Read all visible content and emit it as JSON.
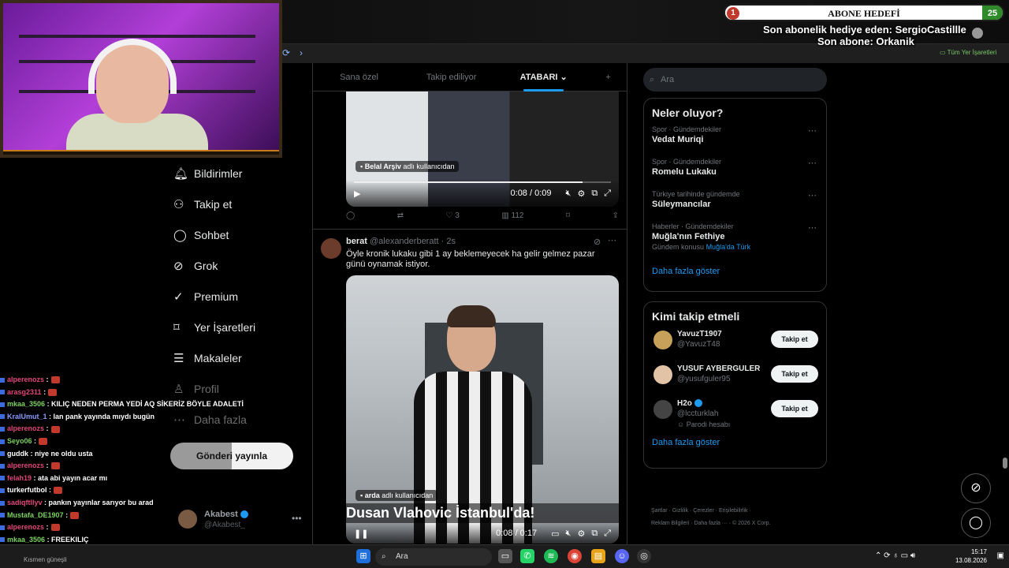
{
  "stream": {
    "goal_title": "ABONE HEDEFİ",
    "goal_start": "1",
    "goal_end": "25",
    "goal_progress": 0.04,
    "last_gift": "Son abonelik hediye eden: SergioCastillle",
    "last_sub": "Son abone: Orkanik"
  },
  "browser": {
    "bookmarks_label": "Tüm Yer İşaretleri"
  },
  "feed": {
    "tabs": [
      {
        "label": "Sana özel"
      },
      {
        "label": "Takip ediliyor"
      },
      {
        "label": "ATABARI ⌄"
      },
      {
        "label": "+"
      }
    ],
    "post1": {
      "credit_name": "Belal Arşiv",
      "credit_suffix": "adlı kullanıcıdan",
      "time": "0:08 / 0:09",
      "progress": 0.89,
      "replies": "",
      "retweets": "",
      "likes": "3",
      "views": "112"
    },
    "post2": {
      "name": "berat",
      "handle": "@alexanderberatt · 2s",
      "text": "Öyle kronik lukaku gibi 1 ay beklemeyecek ha gelir gelmez pazar günü oynamak istiyor.",
      "credit_name": "arda",
      "credit_suffix": "adlı kullanıcıdan",
      "caption": "Dusan Vlahovic İstanbul'da!",
      "time": "0:08 / 0:17"
    }
  },
  "nav": {
    "items": [
      {
        "label": "Bildirimler",
        "icon": "bell-icon"
      },
      {
        "label": "Takip et",
        "icon": "person-add-icon"
      },
      {
        "label": "Sohbet",
        "icon": "chat-icon"
      },
      {
        "label": "Grok",
        "icon": "grok-icon"
      },
      {
        "label": "Premium",
        "icon": "premium-icon"
      },
      {
        "label": "Yer İşaretleri",
        "icon": "bookmark-icon"
      },
      {
        "label": "Makaleler",
        "icon": "article-icon"
      },
      {
        "label": "Profil",
        "icon": "profile-icon"
      },
      {
        "label": "Daha fazla",
        "icon": "more-icon"
      }
    ],
    "post_button": "Gönderi yayınla",
    "account_name": "Akabest",
    "account_handle": "@Akabest_"
  },
  "chat": {
    "lines": [
      {
        "user": "alperenozs",
        "msg": ":",
        "color": "#e0457b"
      },
      {
        "user": "arasg2311",
        "msg": ":",
        "color": "#e0457b"
      },
      {
        "user": "mkaa_3506",
        "msg": ": KILIÇ NEDEN PERMA YEDİ AQ SİKERİZ BÖYLE ADALETİ",
        "color": "#7ad15f"
      },
      {
        "user": "KralUmut_1",
        "msg": ": lan pank yayında mıydı bugün",
        "color": "#8a9cff"
      },
      {
        "user": "alperenozs",
        "msg": ":",
        "color": "#e0457b"
      },
      {
        "user": "Seyo06",
        "msg": ":",
        "color": "#7ad15f"
      },
      {
        "user": "guddk",
        "msg": ": niye ne oldu usta",
        "color": "#ffffff"
      },
      {
        "user": "alperenozs",
        "msg": ":",
        "color": "#e0457b"
      },
      {
        "user": "felah19",
        "msg": ": ata abi yayın acar mı",
        "color": "#e0457b"
      },
      {
        "user": "turkerfutbol",
        "msg": ":",
        "color": "#ffffff"
      },
      {
        "user": "sadiqftllyv",
        "msg": ": pankın yayınlar sarıyor bu arad",
        "color": "#e0457b"
      },
      {
        "user": "Mustafa_DE1907",
        "msg": ":",
        "color": "#7ad15f"
      },
      {
        "user": "alperenozs",
        "msg": ":",
        "color": "#e0457b"
      },
      {
        "user": "mkaa_3506",
        "msg": ": FREEKILIÇ",
        "color": "#7ad15f"
      }
    ]
  },
  "sidebar": {
    "search_placeholder": "Ara",
    "trends_title": "Neler oluyor?",
    "trends": [
      {
        "context": "Spor · Gündemdekiler",
        "name": "Vedat Muriqi",
        "sub": "",
        "sub_link": ""
      },
      {
        "context": "Spor · Gündemdekiler",
        "name": "Romelu Lukaku",
        "sub": "",
        "sub_link": ""
      },
      {
        "context": "Türkiye tarihinde gündemde",
        "name": "Süleymancılar",
        "sub": "",
        "sub_link": ""
      },
      {
        "context": "Haberler · Gündemdekiler",
        "name": "Muğla'nın Fethiye",
        "sub": "Gündem konusu",
        "sub_link": "Muğla'da Türk"
      }
    ],
    "show_more": "Daha fazla göster",
    "who_title": "Kimi takip etmeli",
    "who": [
      {
        "name": "YavuzT1907",
        "handle": "@YavuzT48",
        "label": "",
        "button": "Takip et"
      },
      {
        "name": "YUSUF AYBERGULER",
        "handle": "@yusufguler95",
        "label": "",
        "button": "Takip et"
      },
      {
        "name": "H2o",
        "handle": "@lccturklah",
        "label": "Parodi hesabı",
        "button": "Takip et"
      }
    ],
    "who_more": "Daha fazla göster",
    "footer_line1": "Şartlar · Gizlilik · Çerezler · Erişilebilirlik ·",
    "footer_line2": "Reklam Bilgileri · Daha fazla ··· · © 2026 X Corp."
  },
  "taskbar": {
    "search": "Ara",
    "weather": "Kısmen güneşli",
    "time": "15:17",
    "date": "13.08.2026"
  }
}
